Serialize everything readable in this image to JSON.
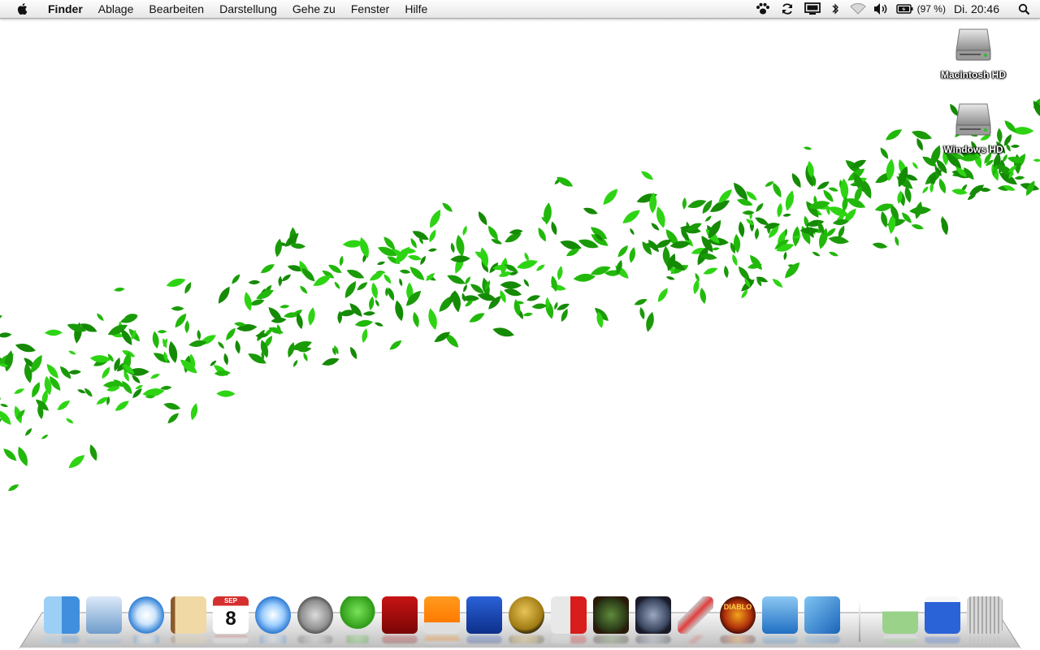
{
  "menubar": {
    "app_name": "Finder",
    "items": [
      "Ablage",
      "Bearbeiten",
      "Darstellung",
      "Gehe zu",
      "Fenster",
      "Hilfe"
    ],
    "status": {
      "battery_percent": "(97 %)",
      "clock": "Di. 20:46",
      "icons": [
        "paw-icon",
        "sync-icon",
        "display-icon",
        "bluetooth-icon",
        "wifi-icon",
        "volume-icon",
        "battery-icon",
        "spotlight-icon"
      ]
    }
  },
  "desktop": {
    "drives": [
      {
        "label": "Macintosh HD"
      },
      {
        "label": "Windows HD"
      }
    ],
    "wallpaper": {
      "leaf_color": "#22b80b",
      "background": "#ffffff"
    }
  },
  "dock": {
    "items": [
      {
        "name": "Finder",
        "icon": "finder-icon"
      },
      {
        "name": "Mail",
        "icon": "mail-icon"
      },
      {
        "name": "Safari",
        "icon": "safari-icon"
      },
      {
        "name": "Adressbuch",
        "icon": "address-book-icon"
      },
      {
        "name": "iCal",
        "icon": "ical-icon",
        "text": "8",
        "month": "SEP"
      },
      {
        "name": "iTunes",
        "icon": "itunes-icon"
      },
      {
        "name": "Systemeinstellungen",
        "icon": "system-preferences-icon"
      },
      {
        "name": "Adium",
        "icon": "adium-icon"
      },
      {
        "name": "Photo Booth",
        "icon": "photo-booth-icon"
      },
      {
        "name": "VLC",
        "icon": "vlc-icon"
      },
      {
        "name": "Vuze",
        "icon": "vuze-icon"
      },
      {
        "name": "Camino",
        "icon": "camino-icon"
      },
      {
        "name": "Parallels",
        "icon": "parallels-icon"
      },
      {
        "name": "Warcraft III",
        "icon": "warcraft-icon"
      },
      {
        "name": "Warcraft III Frozen Throne",
        "icon": "frozen-throne-icon"
      },
      {
        "name": "Airplane",
        "icon": "airplane-icon"
      },
      {
        "name": "Diablo II",
        "icon": "diablo-icon",
        "text": "DIABLO"
      },
      {
        "name": "Preview",
        "icon": "preview-icon"
      },
      {
        "name": "NeoOffice",
        "icon": "neooffice-icon"
      },
      {
        "name": "Spreadsheet",
        "icon": "spreadsheet-icon"
      },
      {
        "name": "Vuze Document",
        "icon": "vuze-doc-icon"
      },
      {
        "name": "Papierkorb",
        "icon": "trash-icon"
      }
    ]
  }
}
